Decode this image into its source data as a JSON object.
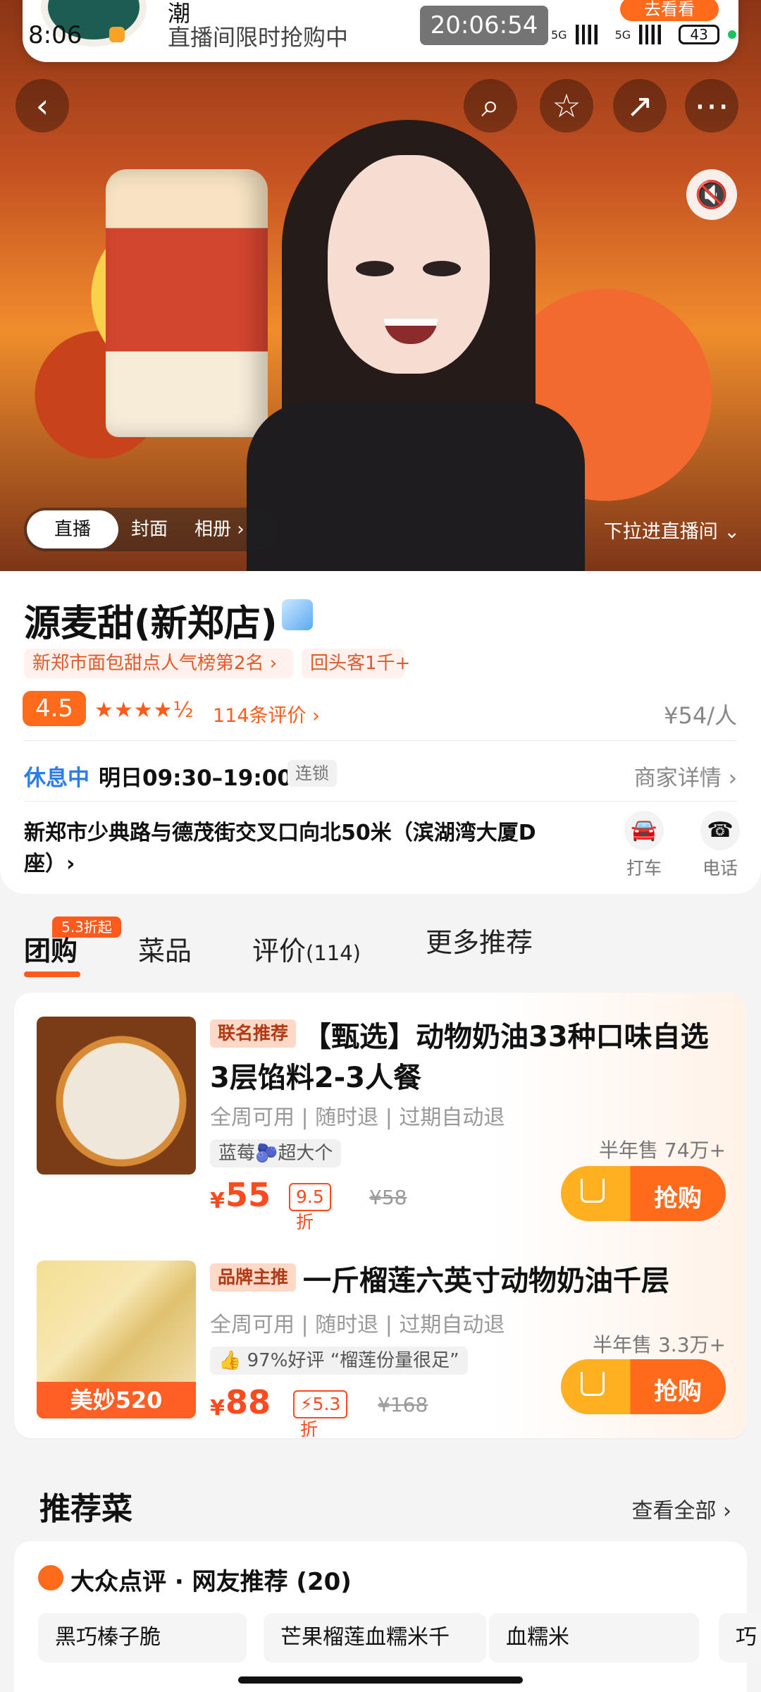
{
  "status_bar": {
    "time": "8:06",
    "timer": "20:06:54",
    "network": "5G",
    "network_alt": "5G",
    "battery": "43"
  },
  "top_banner": {
    "title": "潮",
    "subtitle": "直播间限时抢购中",
    "button": "去看看"
  },
  "hero": {
    "live_tab": "直播",
    "cover_tab": "封面",
    "album_tab": "相册 ›",
    "pull_tip": "下拉进直播间 ⌄"
  },
  "shop": {
    "name": "源麦甜(新郑店)",
    "rank": "新郑市面包甜点人气榜第2名 ›",
    "repeat": "回头客1千+",
    "rating": "4.5",
    "stars": "★★★★½",
    "reviews": "114条评价 ›",
    "avg_price": "¥54/人",
    "status": "休息中",
    "hours": "明日09:30–19:00",
    "chain": "连锁",
    "merchant_details": "商家详情 ›",
    "address": "新郑市少典路与德茂街交叉口向北50米（滨湖湾大厦D座）›",
    "taxi": "打车",
    "phone": "电话"
  },
  "nav": {
    "active_badge": "5.3折起",
    "group_buy": "团购",
    "dishes": "菜品",
    "reviews": "评价",
    "review_count": "(114)",
    "more": "更多推荐"
  },
  "deals": [
    {
      "tag": "联名推荐",
      "title": "【甄选】动物奶油33种口味自选3层馅料2-3人餐",
      "features": "全周可用 | 随时退 | 过期自动退",
      "note": "蓝莓🫐超大个",
      "price": "55",
      "discount": "9.5折",
      "old_price": "¥58",
      "sold": "半年售 74万+",
      "buy": "抢购"
    },
    {
      "tag": "品牌主推",
      "title": "一斤榴莲六英寸动物奶油千层",
      "features": "全周可用 | 随时退 | 过期自动退",
      "note": "👍 97%好评 “榴莲份量很足”",
      "price": "88",
      "discount": "⚡5.3折",
      "old_price": "¥168",
      "sold": "半年售 3.3万+",
      "buy": "抢购",
      "image_label": "美妙520"
    }
  ],
  "recommendations": {
    "title": "推荐菜",
    "view_all": "查看全部 ›",
    "source": "大众点评 · 网友推荐 (20)",
    "dishes": [
      "黑巧榛子脆",
      "芒果榴莲血糯米千",
      "血糯米",
      "巧"
    ]
  },
  "icons": {
    "back": "back-arrow-icon",
    "search": "search-icon",
    "favorite": "star-icon",
    "share": "share-icon",
    "more": "more-icon",
    "mute": "mute-icon",
    "taxi": "car-icon",
    "phone": "phone-icon",
    "cart": "cart-icon"
  },
  "colors": {
    "accent": "#ff6a1b",
    "blue_status": "#2c7de9",
    "price": "#ff4a1f"
  }
}
